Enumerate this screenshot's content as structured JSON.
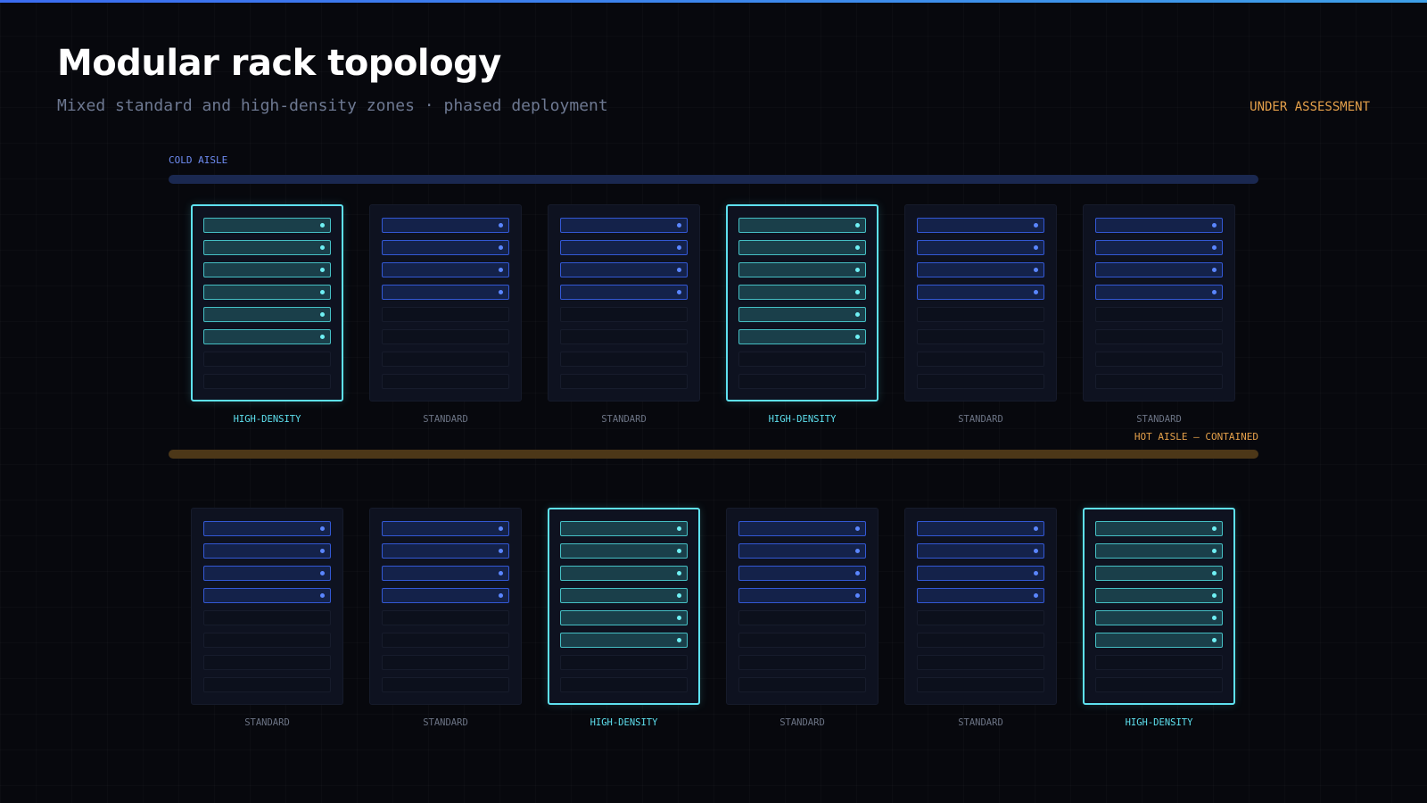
{
  "header": {
    "title": "Modular rack topology",
    "subtitle": "Mixed standard and high-density zones · phased deployment",
    "status": "UNDER ASSESSMENT"
  },
  "aisles": {
    "cold": "COLD AISLE",
    "hot": "HOT AISLE — CONTAINED"
  },
  "colors": {
    "accent": "#5ee1f0",
    "standard": "#3358d4",
    "warning": "#e4a04a"
  },
  "rows": [
    {
      "racks": [
        {
          "type": "high-density",
          "label": "HIGH-DENSITY",
          "filled_units": 6,
          "total_units": 8
        },
        {
          "type": "standard",
          "label": "STANDARD",
          "filled_units": 4,
          "total_units": 8
        },
        {
          "type": "standard",
          "label": "STANDARD",
          "filled_units": 4,
          "total_units": 8
        },
        {
          "type": "high-density",
          "label": "HIGH-DENSITY",
          "filled_units": 6,
          "total_units": 8
        },
        {
          "type": "standard",
          "label": "STANDARD",
          "filled_units": 4,
          "total_units": 8
        },
        {
          "type": "standard",
          "label": "STANDARD",
          "filled_units": 4,
          "total_units": 8
        }
      ]
    },
    {
      "racks": [
        {
          "type": "standard",
          "label": "STANDARD",
          "filled_units": 4,
          "total_units": 8
        },
        {
          "type": "standard",
          "label": "STANDARD",
          "filled_units": 4,
          "total_units": 8
        },
        {
          "type": "high-density",
          "label": "HIGH-DENSITY",
          "filled_units": 6,
          "total_units": 8
        },
        {
          "type": "standard",
          "label": "STANDARD",
          "filled_units": 4,
          "total_units": 8
        },
        {
          "type": "standard",
          "label": "STANDARD",
          "filled_units": 4,
          "total_units": 8
        },
        {
          "type": "high-density",
          "label": "HIGH-DENSITY",
          "filled_units": 6,
          "total_units": 8
        }
      ]
    }
  ]
}
